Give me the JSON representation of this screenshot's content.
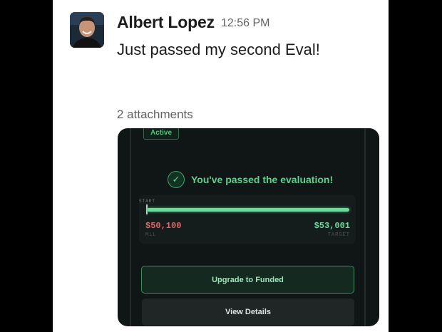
{
  "message": {
    "sender": "Albert Lopez",
    "timestamp": "12:56 PM",
    "text": "Just passed my second Eval!",
    "attachments_label": "2 attachments"
  },
  "screenshot": {
    "badge": "Active",
    "passed_text": "You've passed the evaluation!",
    "start_label": "START",
    "mll_value": "$50,100",
    "mll_label": "MLL",
    "target_value": "$53,001",
    "target_label": "TARGET",
    "progress_fraction": 1.0,
    "upgrade_button": "Upgrade to Funded",
    "details_button": "View Details"
  },
  "colors": {
    "accent_green": "#5fd08d",
    "danger_red": "#e36565",
    "card_bg": "#101515"
  }
}
